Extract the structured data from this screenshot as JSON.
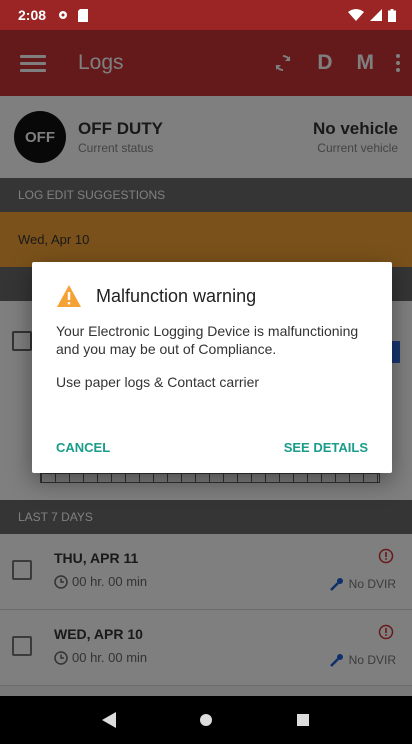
{
  "status_bar": {
    "time": "2:08"
  },
  "app_bar": {
    "title": "Logs",
    "action_d": "D",
    "action_m": "M"
  },
  "duty": {
    "badge": "OFF",
    "status": "OFF DUTY",
    "status_caption": "Current status",
    "vehicle": "No vehicle",
    "vehicle_caption": "Current vehicle"
  },
  "suggestions": {
    "header": "LOG EDIT SUGGESTIONS",
    "item": "Wed, Apr 10"
  },
  "last7": {
    "header": "LAST 7 DAYS",
    "rows": [
      {
        "date": "THU, APR 11",
        "duration": "00 hr. 00 min",
        "dvir": "No DVIR"
      },
      {
        "date": "WED, APR 10",
        "duration": "00 hr. 00 min",
        "dvir": "No DVIR"
      }
    ]
  },
  "dialog": {
    "title": "Malfunction warning",
    "message": "Your Electronic Logging Device is malfunctioning and you may be out of Compliance.",
    "instruction": "Use paper logs & Contact carrier",
    "cancel": "CANCEL",
    "details": "SEE DETAILS"
  },
  "colors": {
    "primary": "#c83434",
    "primary_dark": "#9b2424",
    "warning": "#f5a234",
    "accent": "#1a9c8a",
    "alert": "#d32f2f"
  }
}
